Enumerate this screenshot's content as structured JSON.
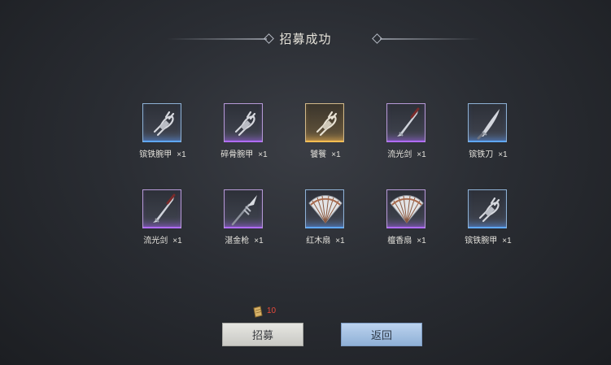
{
  "header": {
    "title": "招募成功"
  },
  "quantity_prefix": "×",
  "items": [
    {
      "name": "镔铁腕甲",
      "qty": "×1",
      "rarity": "blue",
      "icon": "gauntlet-icon"
    },
    {
      "name": "碎骨腕甲",
      "qty": "×1",
      "rarity": "purple",
      "icon": "gauntlet-icon"
    },
    {
      "name": "饕餮",
      "qty": "×1",
      "rarity": "gold",
      "icon": "gauntlet-icon"
    },
    {
      "name": "流光剑",
      "qty": "×1",
      "rarity": "purple",
      "icon": "sword-icon"
    },
    {
      "name": "镔铁刀",
      "qty": "×1",
      "rarity": "blue",
      "icon": "blade-icon"
    },
    {
      "name": "流光剑",
      "qty": "×1",
      "rarity": "purple",
      "icon": "sword-icon"
    },
    {
      "name": "湛金枪",
      "qty": "×1",
      "rarity": "purple",
      "icon": "spear-icon"
    },
    {
      "name": "红木扇",
      "qty": "×1",
      "rarity": "blue",
      "icon": "fan-icon"
    },
    {
      "name": "檀香扇",
      "qty": "×1",
      "rarity": "purple",
      "icon": "fan-icon"
    },
    {
      "name": "镔铁腕甲",
      "qty": "×1",
      "rarity": "blue",
      "icon": "gauntlet-icon"
    }
  ],
  "cost": {
    "amount": "10",
    "icon": "scroll-icon",
    "color": "#e84a3b"
  },
  "buttons": {
    "recruit": "招募",
    "back": "返回"
  },
  "colors": {
    "blue": "#5fa8ff",
    "purple": "#b06cff",
    "gold": "#ffbe52"
  }
}
